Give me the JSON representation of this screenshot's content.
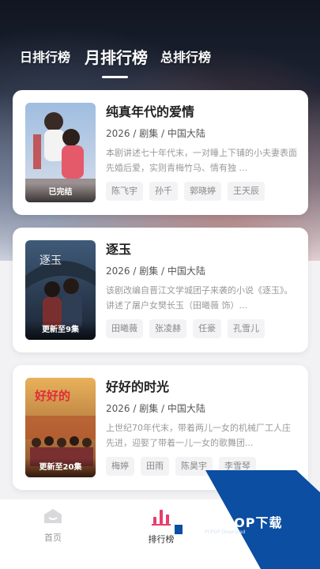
{
  "tabs": {
    "daily": "日排行榜",
    "monthly": "月排行榜",
    "total": "总排行榜"
  },
  "shows": [
    {
      "title": "纯真年代的爱情",
      "meta": "2026 / 剧集 / 中国大陆",
      "desc": "本剧讲述七十年代末，一对睡上下铺的小夫妻表面先婚后爱，实则青梅竹马、情有独 ...",
      "badge": "已完结",
      "actors": [
        "陈飞宇",
        "孙千",
        "郭晓婷",
        "王天辰"
      ]
    },
    {
      "title": "逐玉",
      "meta": "2026 / 剧集 / 中国大陆",
      "desc": "该剧改编自晋江文学城团子来袭的小说《逐玉》。讲述了屠户女樊长玉（田曦薇 饰）...",
      "badge": "更新至9集",
      "poster_text": "逐玉",
      "actors": [
        "田曦薇",
        "张凌赫",
        "任豪",
        "孔雪儿"
      ]
    },
    {
      "title": "好好的时光",
      "meta": "2026 / 剧集 / 中国大陆",
      "desc": "上世纪70年代末，带着两儿一女的机械厂工人庄先进，迎娶了带着一儿一女的歌舞团...",
      "badge": "更新至20集",
      "poster_text": "好好的",
      "actors": [
        "梅婷",
        "田雨",
        "陈昊宇",
        "李雪琴"
      ]
    }
  ],
  "bottom_nav": {
    "home": "首页",
    "rank": "排行榜"
  },
  "watermark": {
    "main": "PCPOP下载",
    "sub": "PCPOP Download"
  },
  "colors": {
    "accent": "#e63e6d",
    "watermark_blue": "#0b4ea2"
  }
}
